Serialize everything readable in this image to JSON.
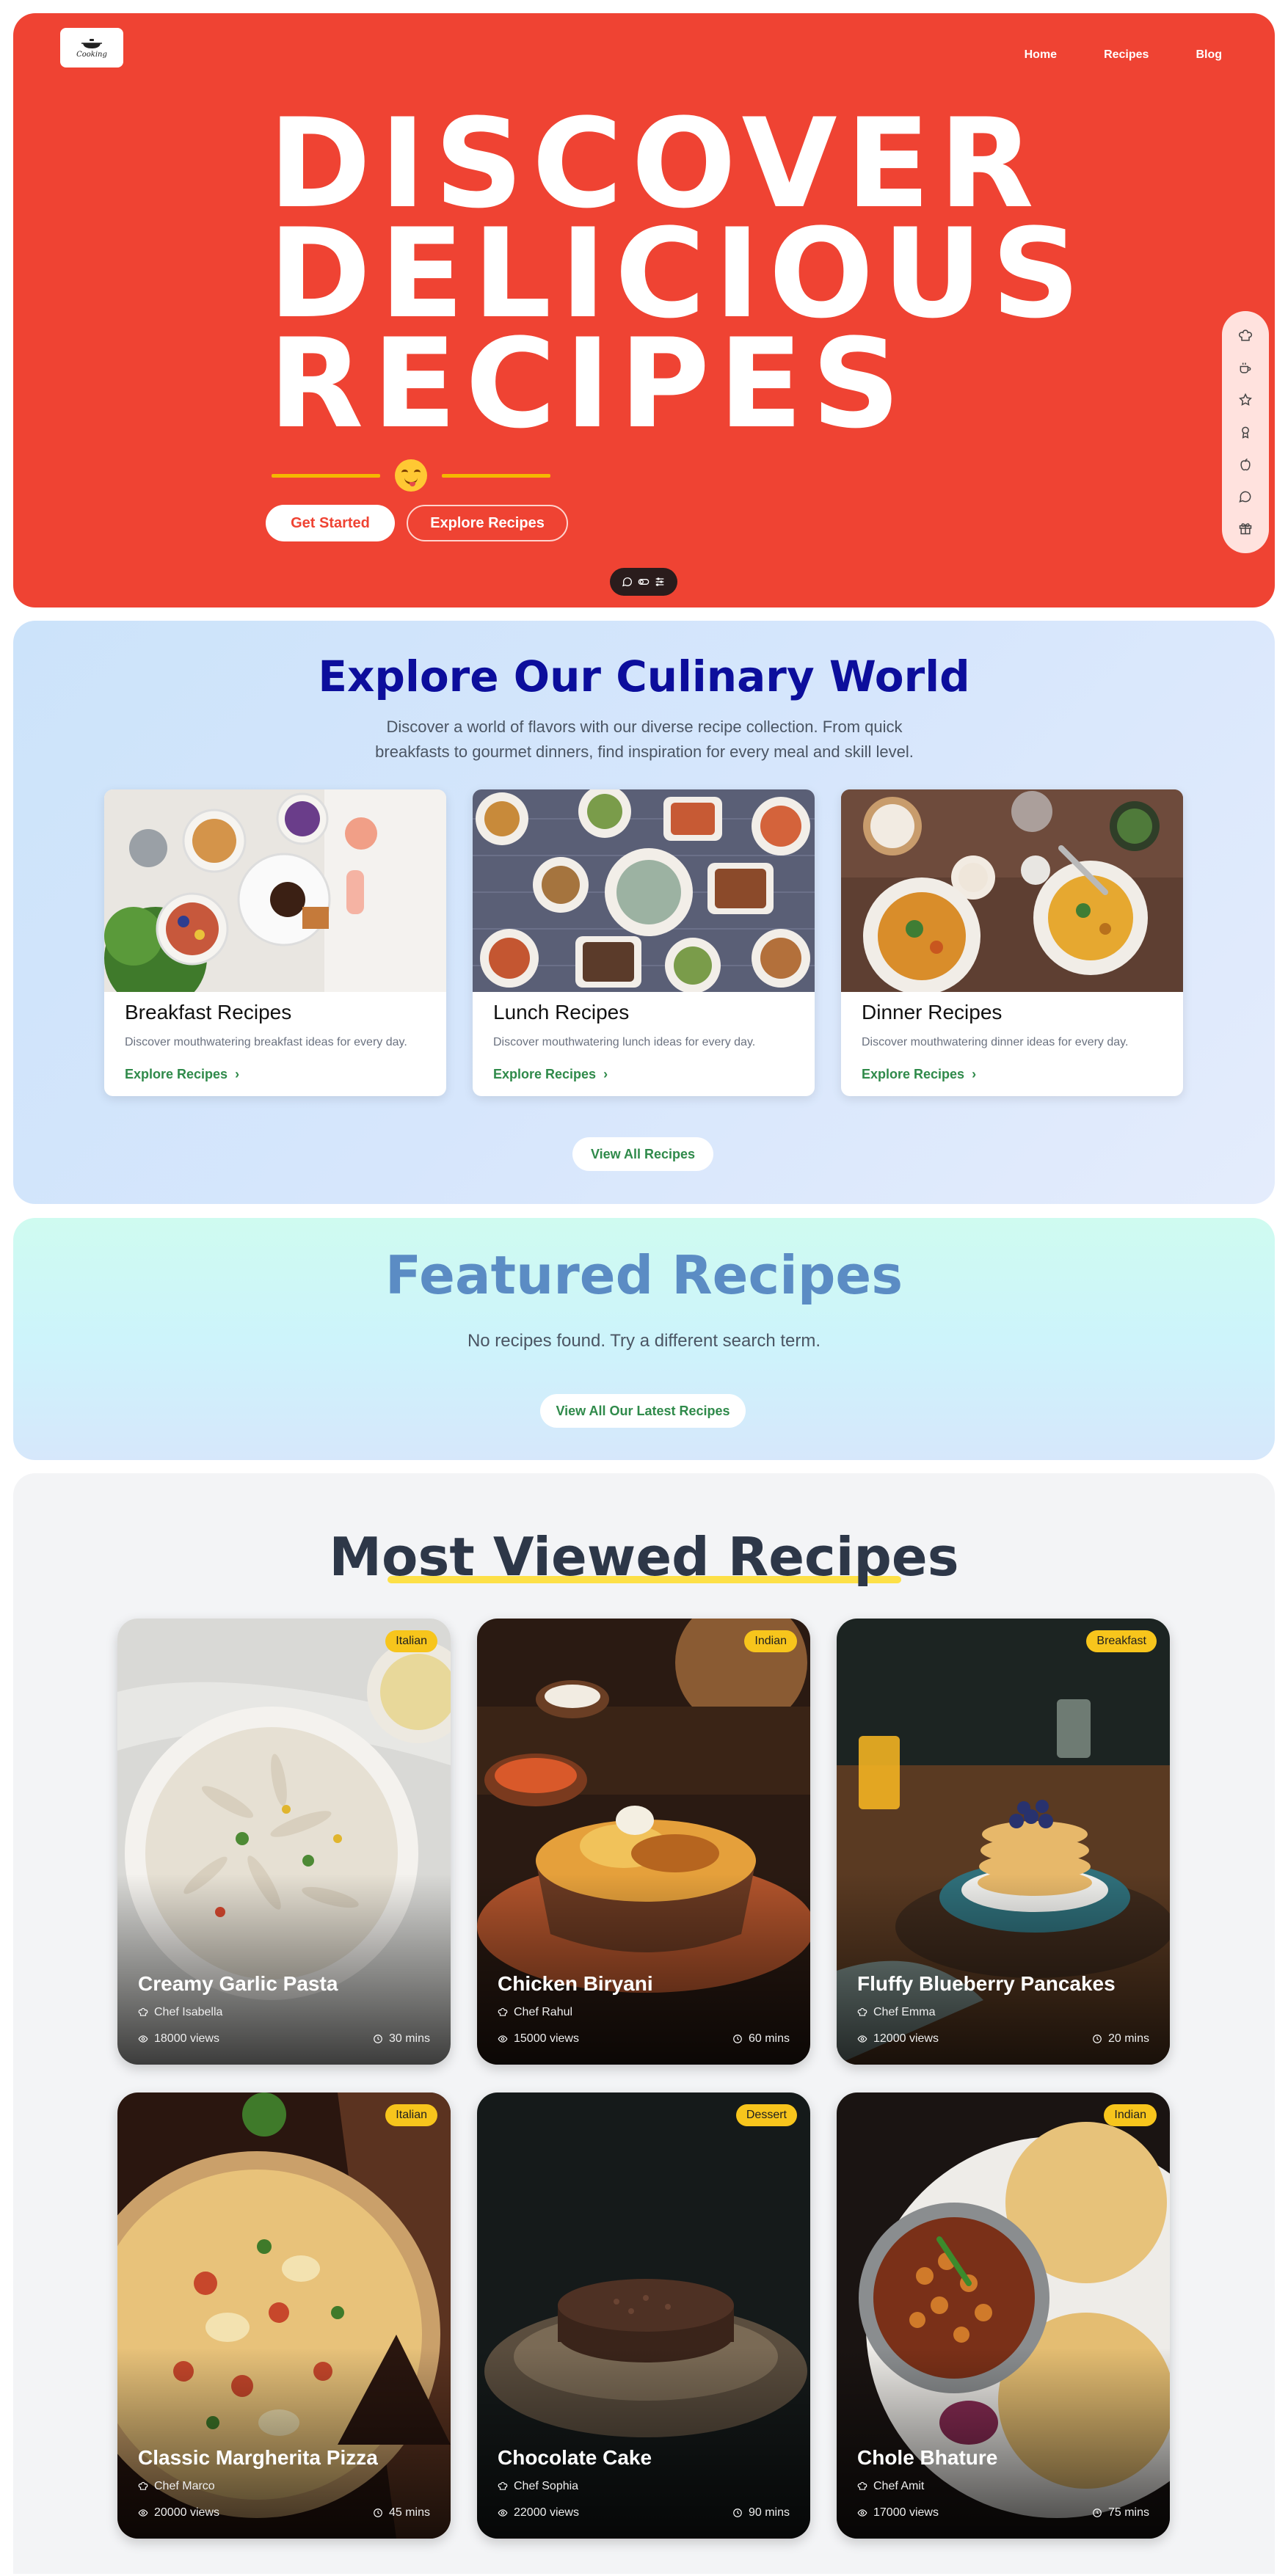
{
  "header": {
    "logo_text": "Cooking",
    "nav": [
      "Home",
      "Recipes",
      "Blog"
    ]
  },
  "hero": {
    "title_lines": [
      "DISCOVER",
      "DELICIOUS",
      "RECIPES"
    ],
    "get_started": "Get Started",
    "explore_recipes": "Explore Recipes",
    "side_icons": [
      "chef-hat-icon",
      "coffee-icon",
      "star-icon",
      "award-icon",
      "apple-icon",
      "message-icon",
      "gift-icon"
    ],
    "pill_icons": [
      "message-icon",
      "toggle-icon",
      "sliders-icon"
    ]
  },
  "explore": {
    "title": "Explore Our Culinary World",
    "subtitle": "Discover a world of flavors with our diverse recipe collection. From quick breakfasts to gourmet dinners, find inspiration for every meal and skill level.",
    "categories": [
      {
        "title": "Breakfast Recipes",
        "desc": "Discover mouthwatering breakfast ideas for every day.",
        "link": "Explore Recipes"
      },
      {
        "title": "Lunch Recipes",
        "desc": "Discover mouthwatering lunch ideas for every day.",
        "link": "Explore Recipes"
      },
      {
        "title": "Dinner Recipes",
        "desc": "Discover mouthwatering dinner ideas for every day.",
        "link": "Explore Recipes"
      }
    ],
    "view_all": "View All Recipes"
  },
  "featured": {
    "title": "Featured Recipes",
    "empty_message": "No recipes found. Try a different search term.",
    "view_latest": "View All Our Latest Recipes"
  },
  "most_viewed": {
    "title": "Most Viewed Recipes",
    "recipes": [
      {
        "name": "Creamy Garlic Pasta",
        "tag": "Italian",
        "chef": "Chef Isabella",
        "views": "18000 views",
        "time": "30 mins"
      },
      {
        "name": "Chicken Biryani",
        "tag": "Indian",
        "chef": "Chef Rahul",
        "views": "15000 views",
        "time": "60 mins"
      },
      {
        "name": "Fluffy Blueberry Pancakes",
        "tag": "Breakfast",
        "chef": "Chef Emma",
        "views": "12000 views",
        "time": "20 mins"
      },
      {
        "name": "Classic Margherita Pizza",
        "tag": "Italian",
        "chef": "Chef Marco",
        "views": "20000 views",
        "time": "45 mins"
      },
      {
        "name": "Chocolate Cake",
        "tag": "Dessert",
        "chef": "Chef Sophia",
        "views": "22000 views",
        "time": "90 mins"
      },
      {
        "name": "Chole Bhature",
        "tag": "Indian",
        "chef": "Chef Amit",
        "views": "17000 views",
        "time": "75 mins"
      }
    ]
  },
  "colors": {
    "hero_red": "#ef4333",
    "explore_title": "#0c0e9c",
    "featured_title": "#5b8cc4",
    "link_green": "#2f8a4a",
    "tag_yellow": "#f7c51c"
  }
}
